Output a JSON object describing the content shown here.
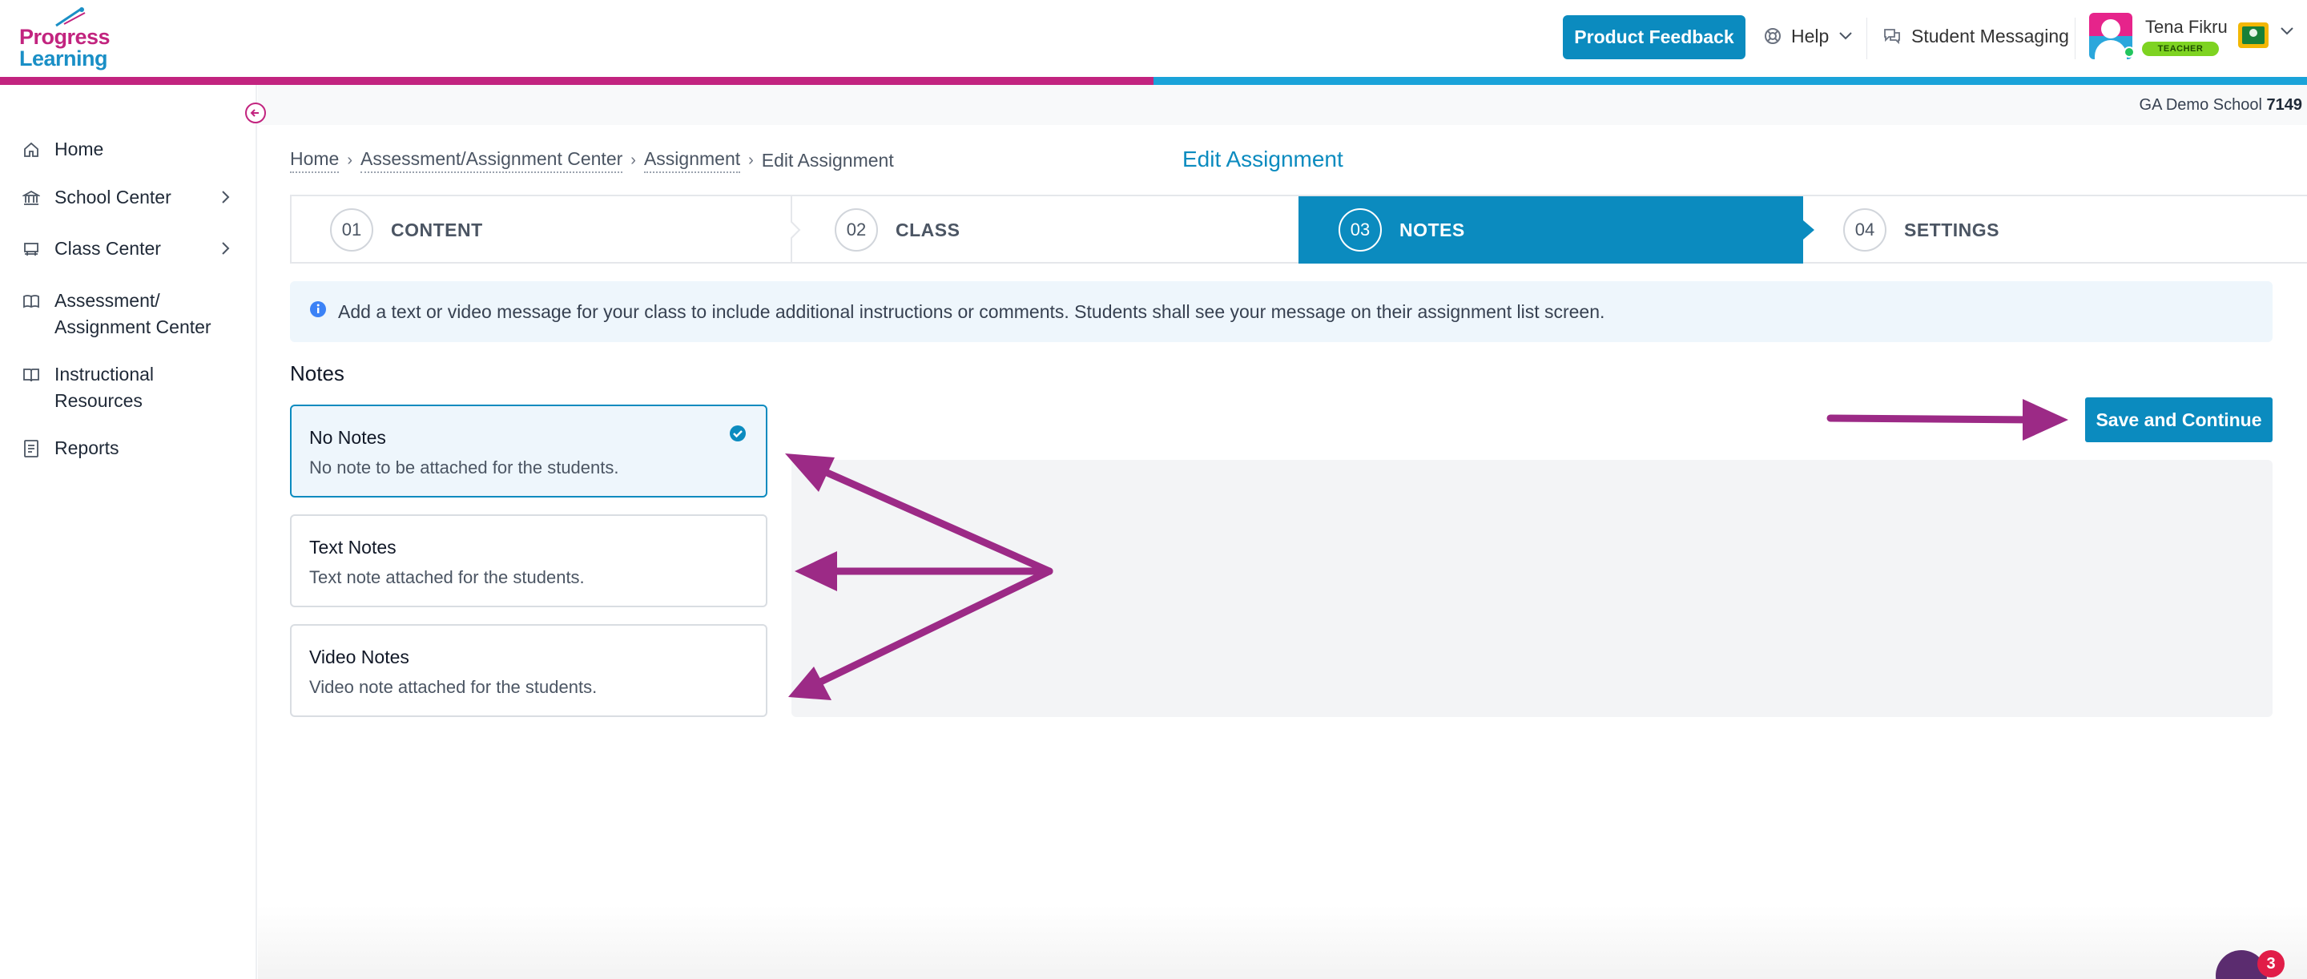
{
  "app": {
    "logo_line1": "Progress",
    "logo_line2": "Learning"
  },
  "header": {
    "feedback_button": "Product Feedback",
    "help_label": "Help",
    "messaging_label": "Student Messaging",
    "user_name": "Tena Fikru",
    "user_role": "TEACHER"
  },
  "school": {
    "name": "GA Demo School",
    "number": "7149"
  },
  "sidebar": {
    "items": [
      {
        "label": "Home",
        "icon": "home-icon"
      },
      {
        "label": "School Center",
        "icon": "school-icon",
        "has_children": true
      },
      {
        "label": "Class Center",
        "icon": "class-icon",
        "has_children": true
      },
      {
        "label_line1": "Assessment/",
        "label_line2": "Assignment Center",
        "icon": "book-open-icon"
      },
      {
        "label_line1": "Instructional",
        "label_line2": "Resources",
        "icon": "book-icon"
      },
      {
        "label": "Reports",
        "icon": "report-icon"
      }
    ]
  },
  "breadcrumb": {
    "items": [
      "Home",
      "Assessment/Assignment Center",
      "Assignment",
      "Edit Assignment"
    ]
  },
  "page": {
    "title": "Edit Assignment"
  },
  "stepper": {
    "steps": [
      {
        "number": "01",
        "label": "CONTENT"
      },
      {
        "number": "02",
        "label": "CLASS"
      },
      {
        "number": "03",
        "label": "NOTES",
        "active": true
      },
      {
        "number": "04",
        "label": "SETTINGS"
      }
    ]
  },
  "info": {
    "text": "Add a text or video message for your class to include additional instructions or comments. Students shall see your message on their assignment list screen."
  },
  "notes": {
    "heading": "Notes",
    "options": [
      {
        "title": "No Notes",
        "description": "No note to be attached for the students.",
        "selected": true
      },
      {
        "title": "Text Notes",
        "description": "Text note attached for the students.",
        "selected": false
      },
      {
        "title": "Video Notes",
        "description": "Video note attached for the students.",
        "selected": false
      }
    ]
  },
  "actions": {
    "save_continue": "Save and Continue"
  },
  "chat": {
    "badge_count": "3"
  },
  "colors": {
    "brand_blue": "#0b8bbf",
    "brand_pink": "#c2247f",
    "annotation_arrow": "#9c2a86"
  }
}
